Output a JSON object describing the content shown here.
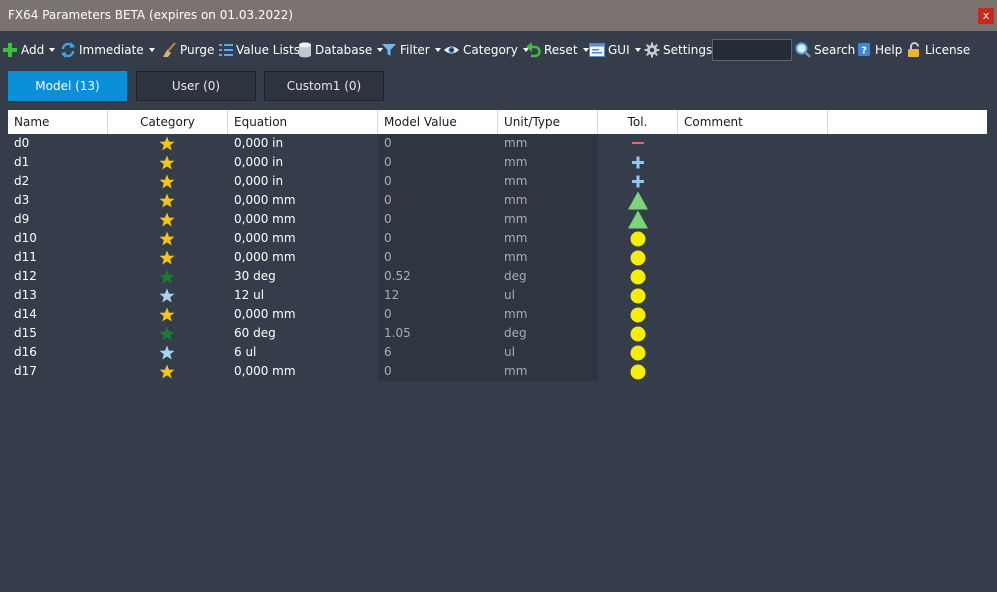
{
  "window": {
    "title": "FX64 Parameters BETA (expires on 01.03.2022)",
    "close_label": "x"
  },
  "toolbar": {
    "add": "Add",
    "immediate": "Immediate",
    "purge": "Purge",
    "value_lists": "Value Lists",
    "database": "Database",
    "filter": "Filter",
    "category": "Category",
    "reset": "Reset",
    "gui": "GUI",
    "settings": "Settings",
    "search_value": "",
    "search": "Search",
    "help": "Help",
    "license": "License"
  },
  "tabs": [
    {
      "label": "Model (13)",
      "active": true
    },
    {
      "label": "User (0)",
      "active": false
    },
    {
      "label": "Custom1 (0)",
      "active": false
    }
  ],
  "table": {
    "columns": [
      "Name",
      "Category",
      "Equation",
      "Model Value",
      "Unit/Type",
      "Tol.",
      "Comment"
    ],
    "rows": [
      {
        "name": "d0",
        "category": "gold-star",
        "equation": "0,000 in",
        "value": "0",
        "unit": "mm",
        "tol": "minus"
      },
      {
        "name": "d1",
        "category": "gold-star",
        "equation": "0,000 in",
        "value": "0",
        "unit": "mm",
        "tol": "plus"
      },
      {
        "name": "d2",
        "category": "gold-star",
        "equation": "0,000 in",
        "value": "0",
        "unit": "mm",
        "tol": "plus"
      },
      {
        "name": "d3",
        "category": "gold-star",
        "equation": "0,000 mm",
        "value": "0",
        "unit": "mm",
        "tol": "triangle"
      },
      {
        "name": "d9",
        "category": "gold-star",
        "equation": "0,000 mm",
        "value": "0",
        "unit": "mm",
        "tol": "triangle"
      },
      {
        "name": "d10",
        "category": "gold-star",
        "equation": "0,000 mm",
        "value": "0",
        "unit": "mm",
        "tol": "circle"
      },
      {
        "name": "d11",
        "category": "gold-star",
        "equation": "0,000 mm",
        "value": "0",
        "unit": "mm",
        "tol": "circle"
      },
      {
        "name": "d12",
        "category": "green-star",
        "equation": "30 deg",
        "value": "0.52",
        "unit": "deg",
        "tol": "circle"
      },
      {
        "name": "d13",
        "category": "blue-star",
        "equation": "12 ul",
        "value": "12",
        "unit": "ul",
        "tol": "circle"
      },
      {
        "name": "d14",
        "category": "gold-star",
        "equation": "0,000 mm",
        "value": "0",
        "unit": "mm",
        "tol": "circle"
      },
      {
        "name": "d15",
        "category": "green-star",
        "equation": "60 deg",
        "value": "1.05",
        "unit": "deg",
        "tol": "circle"
      },
      {
        "name": "d16",
        "category": "blue-star",
        "equation": "6 ul",
        "value": "6",
        "unit": "ul",
        "tol": "circle"
      },
      {
        "name": "d17",
        "category": "gold-star",
        "equation": "0,000 mm",
        "value": "0",
        "unit": "mm",
        "tol": "circle"
      }
    ]
  },
  "colors": {
    "accent": "#0b8fd8",
    "background": "#363d4a",
    "titlebar": "#7a736f",
    "star_gold": "#f5c518",
    "star_green": "#1e7a2e",
    "star_blue": "#a8d4f2",
    "tol_minus": "#e06b6b",
    "tol_plus": "#8cc7f5",
    "tol_triangle": "#7bd67b",
    "tol_circle": "#f5ee00"
  }
}
